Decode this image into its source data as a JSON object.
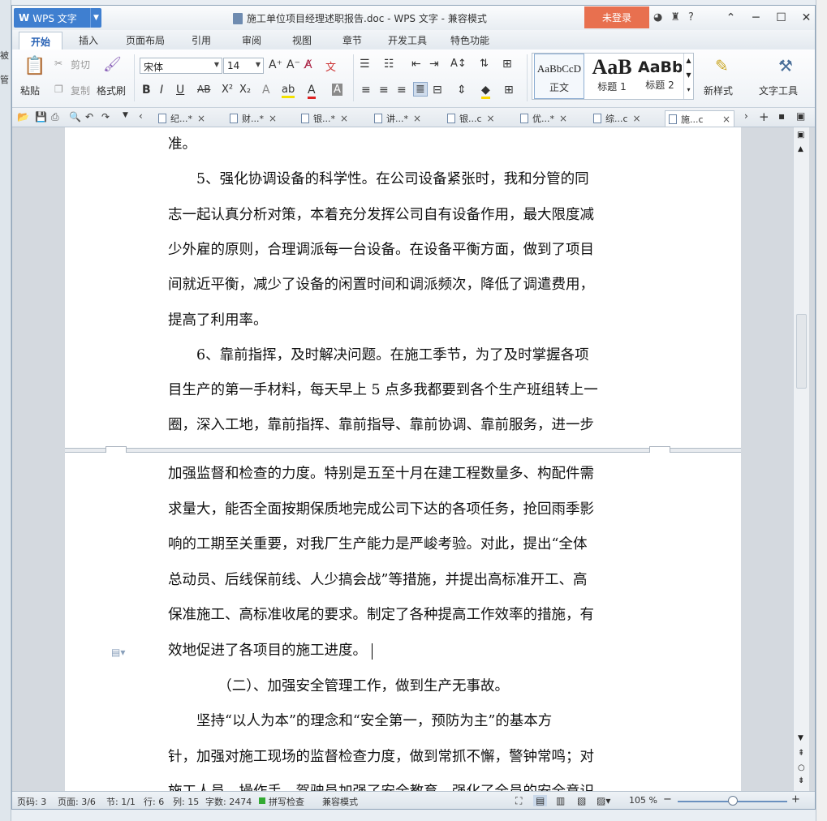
{
  "app": {
    "name": "WPS 文字",
    "logo_letter": "W"
  },
  "window": {
    "title": "施工单位项目经理述职报告.doc - WPS 文字 - 兼容模式",
    "login": "未登录",
    "help_label": "?"
  },
  "left_strip": [
    "被",
    "管"
  ],
  "tabs": [
    "开始",
    "插入",
    "页面布局",
    "引用",
    "审阅",
    "视图",
    "章节",
    "开发工具",
    "特色功能"
  ],
  "ribbon": {
    "paste": "粘贴",
    "cut": "剪切",
    "copy": "复制",
    "format_painter": "格式刷",
    "font_name": "宋体",
    "font_size": "14",
    "styles": [
      {
        "preview": "AaBbCcD",
        "label": "正文"
      },
      {
        "preview": "AaB",
        "label": "标题 1"
      },
      {
        "preview": "AaBb(",
        "label": "标题 2"
      }
    ],
    "new_style": "新样式",
    "text_tools": "文字工具"
  },
  "doc_tabs": [
    "纪...*",
    "财...*",
    "银...*",
    "讲...*",
    "银...c",
    "优...*",
    "综...c",
    "施...c"
  ],
  "document": {
    "page1_lines": [
      "准。",
      "　　5、强化协调设备的科学性。在公司设备紧张时，我和分管的同",
      "志一起认真分析对策，本着充分发挥公司自有设备作用，最大限度减",
      "少外雇的原则，合理调派每一台设备。在设备平衡方面，做到了项目",
      "间就近平衡，减少了设备的闲置时间和调派频次，降低了调遣费用，",
      "提高了利用率。",
      "　　6、靠前指挥，及时解决问题。在施工季节，为了及时掌握各项",
      "目生产的第一手材料，每天早上 5 点多我都要到各个生产班组转上一",
      "圈，深入工地，靠前指挥、靠前指导、靠前协调、靠前服务，进一步"
    ],
    "page2_lines": [
      "加强监督和检查的力度。特别是五至十月在建工程数量多、构配件需",
      "求量大，能否全面按期保质地完成公司下达的各项任务，抢回雨季影",
      "响的工期至关重要，对我厂生产能力是严峻考验。对此，提出“全体",
      "总动员、后线保前线、人少搞会战”等措施，并提出高标准开工、高",
      "保准施工、高标准收尾的要求。制定了各种提高工作效率的措施，有",
      "效地促进了各项目的施工进度。",
      "　　　　（二）、加强安全管理工作，做到生产无事故。",
      "　　坚持“以人为本”的理念和“安全第一，预防为主”的基本方",
      "针，加强对施工现场的监督检查力度，做到常抓不懈，警钟常鸣；对",
      "施工人员、操作手、驾驶员加强了安全教育，强化了全员的安全意识，"
    ]
  },
  "status": {
    "page_code": "页码: 3",
    "page": "页面: 3/6",
    "section": "节: 1/1",
    "row": "行: 6",
    "col": "列: 15",
    "chars": "字数: 2474",
    "spell": "拼写检查",
    "compat": "兼容模式",
    "zoom": "105 %",
    "zoom_level": 0.5
  }
}
